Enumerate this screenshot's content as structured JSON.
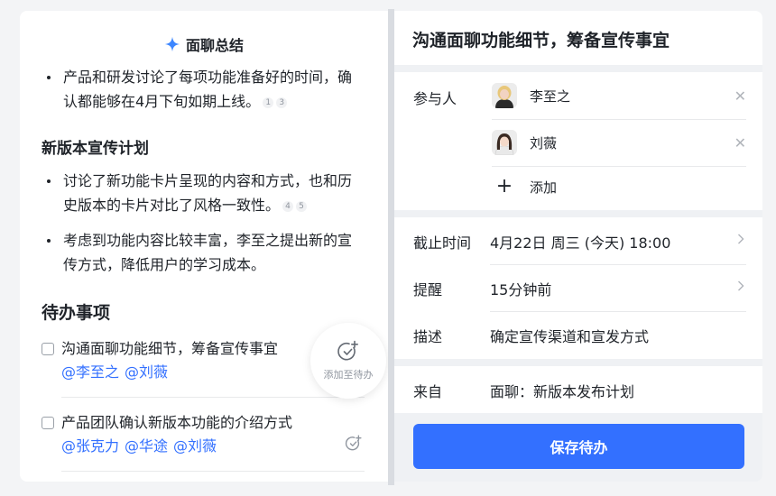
{
  "left": {
    "title": "面聊总结",
    "bullet1": {
      "text": "产品和研发讨论了每项功能准备好的时间，确认都能够在4月下旬如期上线。",
      "refs": [
        "1",
        "3"
      ]
    },
    "section_new_promo": "新版本宣传计划",
    "bullet2": {
      "text": "讨论了新功能卡片呈现的内容和方式，也和历史版本的卡片对比了风格一致性。",
      "refs": [
        "4",
        "5"
      ]
    },
    "bullet3": {
      "text": "考虑到功能内容比较丰富，李至之提出新的宣传方式，降低用户的学习成本。"
    },
    "todo_title": "待办事项",
    "todos": [
      {
        "text": "沟通面聊功能细节，筹备宣传事宜",
        "mentions": [
          "@李至之",
          "@刘薇"
        ]
      },
      {
        "text": "产品团队确认新版本功能的介绍方式",
        "mentions": [
          "@张克力",
          "@华途",
          "@刘薇"
        ]
      }
    ],
    "add_todo_label": "添加至待办"
  },
  "right": {
    "title": "沟通面聊功能细节，筹备宣传事宜",
    "participants_label": "参与人",
    "participants": [
      {
        "name": "李至之"
      },
      {
        "name": "刘薇"
      }
    ],
    "add_label": "添加",
    "deadline_label": "截止时间",
    "deadline_value": "4月22日 周三 (今天) 18:00",
    "remind_label": "提醒",
    "remind_value": "15分钟前",
    "desc_label": "描述",
    "desc_value": "确定宣传渠道和宣发方式",
    "source_label": "来自",
    "source_value": "面聊：新版本发布计划",
    "save_label": "保存待办"
  },
  "colors": {
    "accent": "#3370ff",
    "panel_bg": "#eff1f4",
    "divider_bar": "#d9dce1"
  },
  "icons": [
    "sparkle-icon",
    "todo-add-icon",
    "close-icon",
    "plus-icon",
    "chevron-right-icon"
  ]
}
